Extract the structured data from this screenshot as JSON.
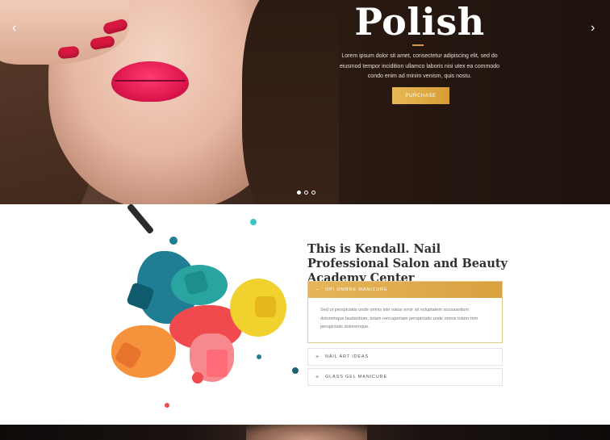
{
  "hero": {
    "title": "Polish",
    "text": "Lorem ipsum dolor sit amet, consectetur adipiscing elit, sed do eiusmod tempor incidition ullamco laboris nisi utex ea commodo condo enim ad minim venism, quis nostu.",
    "button_label": "PURCHASE",
    "arrow_left": "‹",
    "arrow_right": "›",
    "slides": 3,
    "active_slide": 1
  },
  "about": {
    "title": "This is Kendall. Nail Professional Salon and Beauty Academy Center",
    "accordion": [
      {
        "sign": "−",
        "label": "OPI OMBRE MANICURE",
        "open": true,
        "body": "Sed ut perspiciatis unde omnis iste natus error sit voluptatem accusantium doloremque laudantium, totam rem aperiam perspiciatis unde omnis totam rem perspiciatis doloremque."
      },
      {
        "sign": "+",
        "label": "NAIL ART IDEAS",
        "open": false
      },
      {
        "sign": "+",
        "label": "GLASS GEL MANICURE",
        "open": false
      }
    ]
  },
  "colors": {
    "accent": "#e0ac4c",
    "hero_bg": "#1d120d"
  },
  "icons": [
    "chevron-left-icon",
    "chevron-right-icon"
  ]
}
